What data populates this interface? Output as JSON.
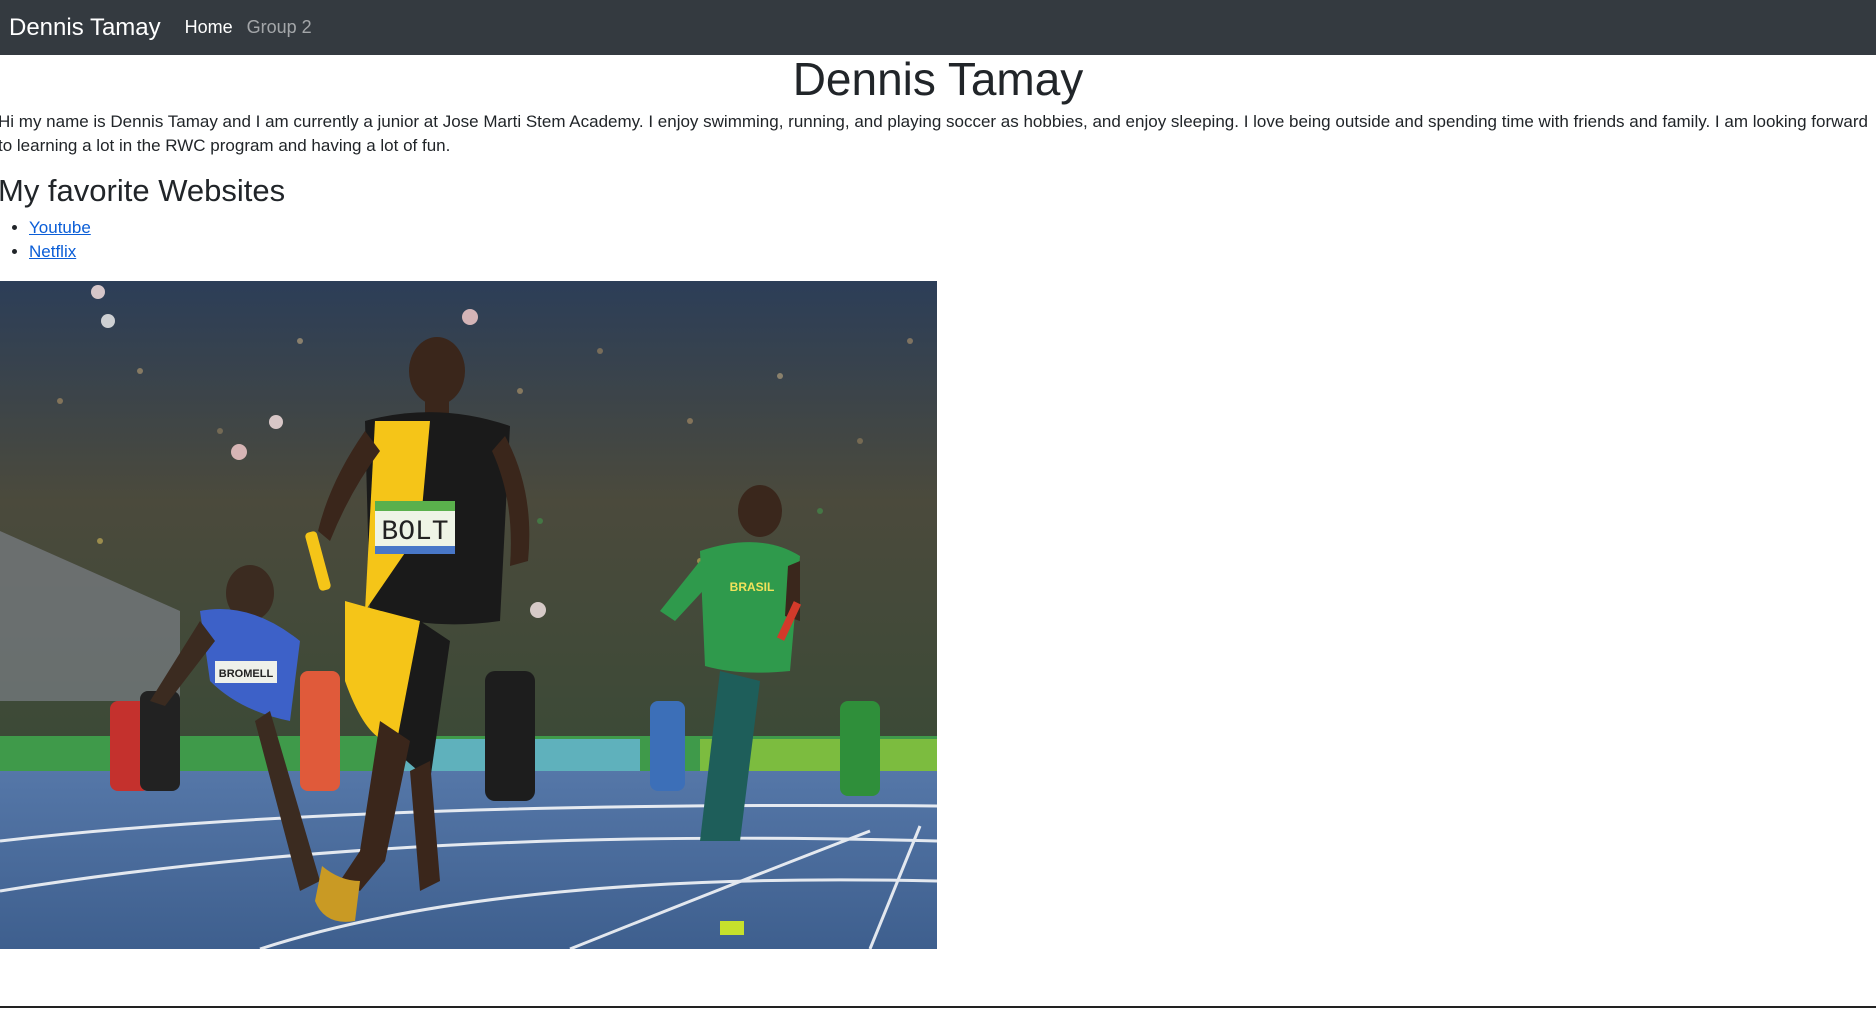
{
  "navbar": {
    "brand": "Dennis Tamay",
    "links": [
      {
        "label": "Home",
        "active": true
      },
      {
        "label": "Group 2",
        "active": false
      }
    ]
  },
  "main": {
    "title": "Dennis Tamay",
    "intro": "Hi my name is Dennis Tamay and I am currently a junior at Jose Marti Stem Academy. I enjoy swimming, running, and playing soccer as hobbies, and enjoy sleeping. I love being outside and spending time with friends and family. I am looking forward to learning a lot in the RWC program and having a lot of fun.",
    "favorites_heading": "My favorite Websites",
    "favorites": [
      "Youtube",
      "Netflix"
    ]
  },
  "photo": {
    "bib_main": "BOLT",
    "bib_left": "BROMELL",
    "jersey_right": "BRASIL"
  },
  "colors": {
    "navbar_bg": "#343a40",
    "link": "#0b5ed7",
    "jamaica_yellow": "#f5c518",
    "track_blue": "#4a6fa5"
  }
}
